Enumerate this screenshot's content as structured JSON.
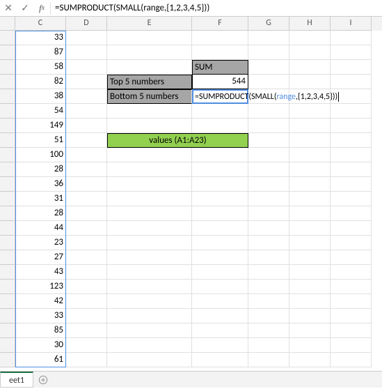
{
  "formula_bar": {
    "formula": "=SUMPRODUCT(SMALL(range,{1,2,3,4,5}))"
  },
  "columns": [
    "C",
    "D",
    "E",
    "F",
    "G",
    "H",
    "I"
  ],
  "col_c_values": [
    "33",
    "87",
    "58",
    "82",
    "38",
    "54",
    "149",
    "51",
    "100",
    "28",
    "36",
    "31",
    "28",
    "44",
    "23",
    "27",
    "43",
    "123",
    "42",
    "33",
    "85",
    "30",
    "61"
  ],
  "labels": {
    "sum": "SUM",
    "top5": "Top 5 numbers",
    "bottom5": "Bottom 5 numbers",
    "values_range": "values (A1:A23)"
  },
  "values": {
    "top5_sum": "544"
  },
  "editing_formula": {
    "prefix": "=SUMPRODUCT(SMALL(",
    "range": "range",
    "suffix": ",{1,2,3,4,5}))"
  },
  "sheet": {
    "name": "eet1"
  },
  "chart_data": null
}
